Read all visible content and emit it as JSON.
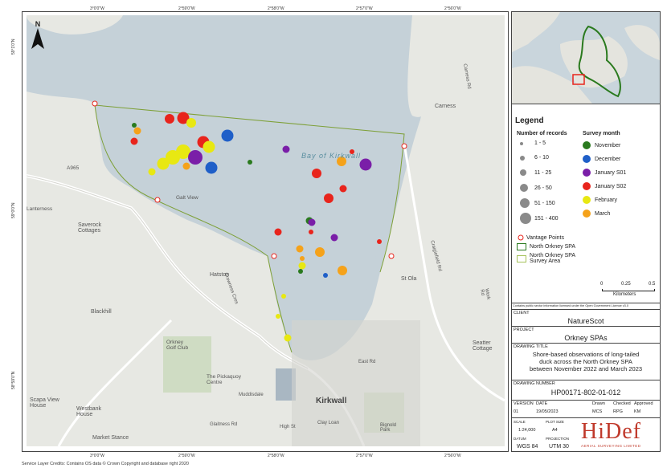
{
  "map": {
    "north_label": "N",
    "top_ticks": [
      "3°0'0\"W",
      "2°59'0\"W",
      "2°58'0\"W",
      "2°57'0\"W",
      "2°56'0\"W"
    ],
    "left_ticks": [
      "59°1'0\"N",
      "59°0'0\"N",
      "58°59'0\"N"
    ],
    "place_labels": {
      "bay": "Bay of Kirkwall",
      "kirkwall": "Kirkwall",
      "saverock": "Saverock\nCottages",
      "hatston": "Hatston",
      "blackhill": "Blackhill",
      "golf": "Orkney\nGolf Club",
      "pickaquoy": "The Pickaquoy\nCentre",
      "scapa": "Scapa View\nHouse",
      "westbank": "Westbank\nHouse",
      "market": "Market Stance",
      "carness": "Carness",
      "stola": "St Ola",
      "seatter": "Seatter\nCottage",
      "galtview": "Galt View",
      "canterness": "Lanterness",
      "a965": "A965",
      "muddisdale": "Muddisdale",
      "glaitness": "Glaitness Rd",
      "claylown": "Clay Loan",
      "bignold": "Bignold\nPark",
      "highst": "High St",
      "eastrd": "East Rd",
      "carnessrd": "Carness Rd",
      "craigiefield": "Craigiefield Rd",
      "workrd": "Work Rd",
      "crowness": "Crowness Cres"
    },
    "points": [
      {
        "m": "January S02",
        "s": 3
      },
      {
        "m": "January S02",
        "s": 4
      },
      {
        "m": "March",
        "s": 2
      },
      {
        "m": "February",
        "s": 3
      },
      {
        "m": "November",
        "s": 1
      },
      {
        "m": "February",
        "s": 5
      },
      {
        "m": "February",
        "s": 5
      },
      {
        "m": "February",
        "s": 4
      },
      {
        "m": "January S01",
        "s": 5
      },
      {
        "m": "January S02",
        "s": 4
      },
      {
        "m": "February",
        "s": 4
      },
      {
        "m": "December",
        "s": 4
      },
      {
        "m": "December",
        "s": 4
      },
      {
        "m": "March",
        "s": 2
      },
      {
        "m": "February",
        "s": 2
      },
      {
        "m": "January S02",
        "s": 2
      },
      {
        "m": "November",
        "s": 1
      },
      {
        "m": "January S01",
        "s": 2
      },
      {
        "m": "January S02",
        "s": 3
      },
      {
        "m": "January S01",
        "s": 4
      },
      {
        "m": "March",
        "s": 3
      },
      {
        "m": "January S02",
        "s": 3
      },
      {
        "m": "January S02",
        "s": 2
      },
      {
        "m": "January S02",
        "s": 2
      },
      {
        "m": "November",
        "s": 2
      },
      {
        "m": "January S01",
        "s": 2
      },
      {
        "m": "January S02",
        "s": 1
      },
      {
        "m": "January S01",
        "s": 2
      },
      {
        "m": "March",
        "s": 2
      },
      {
        "m": "March",
        "s": 3
      },
      {
        "m": "February",
        "s": 2
      },
      {
        "m": "November",
        "s": 1
      },
      {
        "m": "March",
        "s": 3
      },
      {
        "m": "December",
        "s": 1
      },
      {
        "m": "January S02",
        "s": 1
      },
      {
        "m": "February",
        "s": 1
      },
      {
        "m": "February",
        "s": 2
      },
      {
        "m": "March",
        "s": 1
      },
      {
        "m": "February",
        "s": 1
      },
      {
        "m": "January S02",
        "s": 1
      }
    ]
  },
  "legend": {
    "title": "Legend",
    "records_heading": "Number of records",
    "records": [
      "1 - 5",
      "6 - 10",
      "11 - 25",
      "26 - 50",
      "51 - 150",
      "151 - 400"
    ],
    "month_heading": "Survey month",
    "months": [
      {
        "label": "November",
        "color": "#2a7a1e"
      },
      {
        "label": "December",
        "color": "#1f5fc8"
      },
      {
        "label": "January S01",
        "color": "#7a1ea8"
      },
      {
        "label": "January S02",
        "color": "#e8241c"
      },
      {
        "label": "February",
        "color": "#e8e812"
      },
      {
        "label": "March",
        "color": "#f5a21a"
      }
    ],
    "vantage": "Vantage Points",
    "spa": "North Orkney SPA",
    "survey_area": "North Orkney SPA\nSurvey Area",
    "scale_ticks": [
      "0",
      "0.25",
      "0.5"
    ],
    "scale_unit": "Kilometers",
    "licence": "Contains public sector information licensed under the Open Government Licence v3.0"
  },
  "titleblock": {
    "client_label": "CLIENT",
    "client": "NatureScot",
    "project_label": "PROJECT",
    "project": "Orkney SPAs",
    "drawing_title_label": "DRAWING TITLE",
    "drawing_title": "Shore-based observations of long-tailed\nduck across the North Orkney SPA\nbetween November 2022 and March 2023",
    "drawing_number_label": "DRAWING NUMBER",
    "drawing_number": "HP00171-802-01-012",
    "version_label": "VERSION",
    "version": "01",
    "date_label": "DATE",
    "date": "19/05/2023",
    "drawn_label": "Drawn",
    "drawn": "MCS",
    "checked_label": "Checked",
    "checked": "RPG",
    "approved_label": "Approved",
    "approved": "KM",
    "scale_label": "SCALE",
    "scale": "1:24,000",
    "plot_label": "PLOT SIZE",
    "plot": "A4",
    "datum_label": "DATUM",
    "datum": "WGS 84",
    "projection_label": "PROJECTION",
    "projection": "UTM 30",
    "logo_text": "HiDef",
    "logo_sub": "AERIAL SURVEYING LIMITED"
  },
  "credit": "Service Layer Credits: Contains OS data © Crown Copyright and database right 2020"
}
